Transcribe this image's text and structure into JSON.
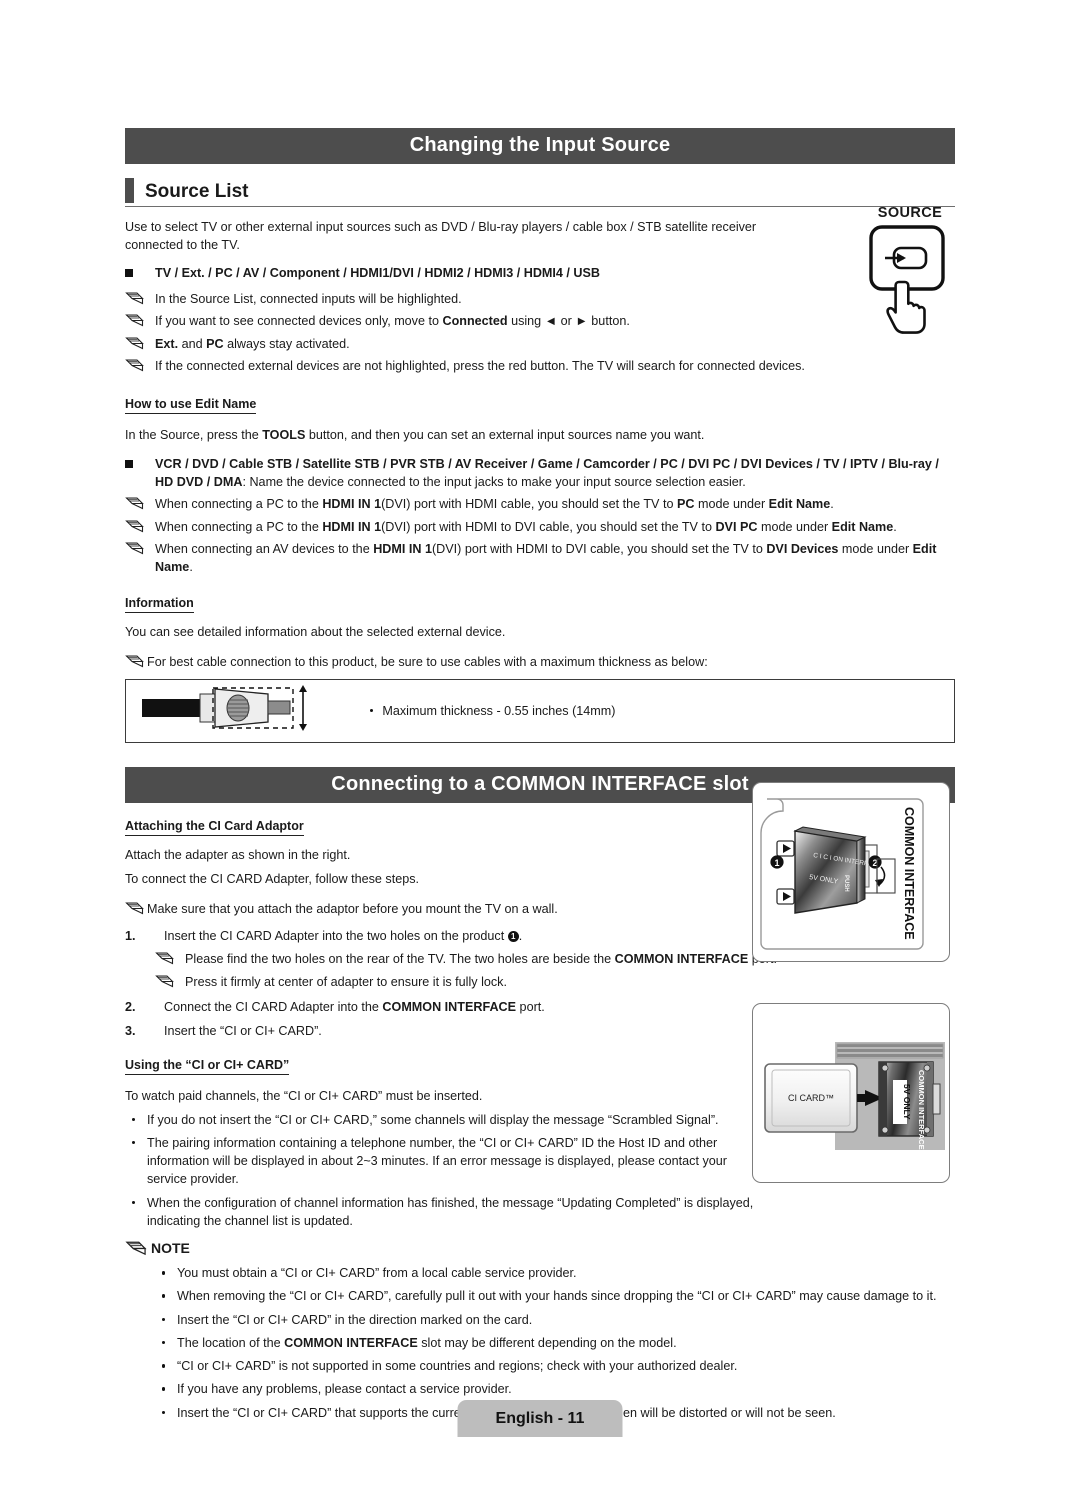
{
  "banner1": "Changing the Input Source",
  "banner2": "Connecting to a COMMON INTERFACE slot",
  "section1": {
    "title": "Source List",
    "intro": "Use to select TV or other external input sources such as DVD / Blu-ray players / cable box / STB satellite receiver connected to the TV.",
    "source_list": "TV / Ext. / PC / AV / Component / HDMI1/DVI / HDMI2 / HDMI3 / HDMI4 / USB",
    "notes": [
      "In the Source List, connected inputs will be highlighted.",
      "If you want to see connected devices only, move to Connected using ◄ or ► button.",
      "Ext. and PC always stay activated.",
      "If the connected external devices are not highlighted, press the red button. The TV will search for connected devices."
    ],
    "source_button_label": "SOURCE"
  },
  "edit_name": {
    "heading": "How to use Edit Name",
    "intro": "In the Source, press the TOOLS button, and then you can set an external input sources name you want.",
    "device_list_bold": "VCR / DVD / Cable STB / Satellite STB / PVR STB / AV Receiver / Game / Camcorder / PC / DVI PC / DVI Devices / TV / IPTV / Blu-ray / HD DVD / DMA",
    "device_list_rest": ": Name the device connected to the input jacks to make your input source selection easier.",
    "notes": [
      "When connecting a PC to the HDMI IN 1(DVI) port with HDMI cable, you should set the TV to PC mode under Edit Name.",
      "When connecting a PC to the HDMI IN 1(DVI) port with HDMI to DVI cable, you should set the TV to DVI PC mode under Edit Name.",
      "When connecting an AV devices to the HDMI IN 1(DVI) port with HDMI to DVI cable, you should set the TV to DVI Devices mode under Edit Name."
    ]
  },
  "information": {
    "heading": "Information",
    "text": "You can see detailed information about the selected external device.",
    "note": "For best cable connection to this product, be sure to use cables with a maximum thickness as below:",
    "box_text": "Maximum thickness - 0.55 inches (14mm)"
  },
  "ci_adaptor": {
    "heading": "Attaching the CI Card Adaptor",
    "line1": "Attach the adapter as shown in the right.",
    "line2": "To connect the CI CARD Adapter, follow these steps.",
    "note1": "Make sure that you attach the adaptor before you mount the TV on a wall.",
    "step1_num": "1.",
    "step1_pre": "Insert the CI CARD Adapter into the two holes on the product ",
    "step1_post": ".",
    "step1_circle": "1",
    "step1_note1": "Please find the two holes on the rear of the TV. The two holes are beside the COMMON INTERFACE port.",
    "step1_note2": "Press it firmly at center of adapter to ensure it is fully lock.",
    "step2_num": "2.",
    "step2": "Connect the CI CARD Adapter into the COMMON INTERFACE port.",
    "step3_num": "3.",
    "step3": "Insert the “CI or CI+ CARD”.",
    "figure": {
      "common_interface_label": "COMMON INTERFACE",
      "card_side_label": "CI CARD 5V ONLY",
      "push_label": "PUSH",
      "callout1": "1",
      "callout2": "2"
    }
  },
  "using_card": {
    "heading": "Using the “CI or CI+ CARD”",
    "intro": "To watch paid channels, the “CI or CI+ CARD” must be inserted.",
    "bullets": [
      "If you do not insert the “CI or CI+ CARD,” some channels will display the message “Scrambled Signal”.",
      "The pairing information containing a telephone number, the “CI or CI+ CARD” ID the Host ID and other information will be displayed in about 2~3 minutes. If an error message is displayed, please contact your service provider.",
      "When the configuration of channel information has finished, the message “Updating Completed” is displayed, indicating the channel list is updated."
    ],
    "figure": {
      "card_label": "CI CARD™",
      "slot_label_1": "COMMON INTERFACE",
      "slot_label_2": "5V ONLY"
    }
  },
  "note_block": {
    "heading": "NOTE",
    "items": [
      "You must obtain a “CI or CI+ CARD” from a local cable service provider.",
      "When removing the “CI or CI+ CARD”, carefully pull it out with your hands since dropping the “CI or CI+ CARD” may cause damage to it.",
      "Insert the “CI or CI+ CARD” in the direction marked on the card.",
      "The location of the COMMON INTERFACE slot may be different depending on the model.",
      "“CI or CI+ CARD” is not supported in some countries and regions; check with your authorized dealer.",
      "If you have any problems, please contact a service provider.",
      "Insert the “CI or CI+ CARD” that supports the current antenna settings. The screen will be distorted or will not be seen."
    ]
  },
  "footer": "English - 11",
  "colors": {
    "banner_bg": "#4d4d4d",
    "footer_bg": "#bdbdbd",
    "text": "#1a1a1a"
  }
}
